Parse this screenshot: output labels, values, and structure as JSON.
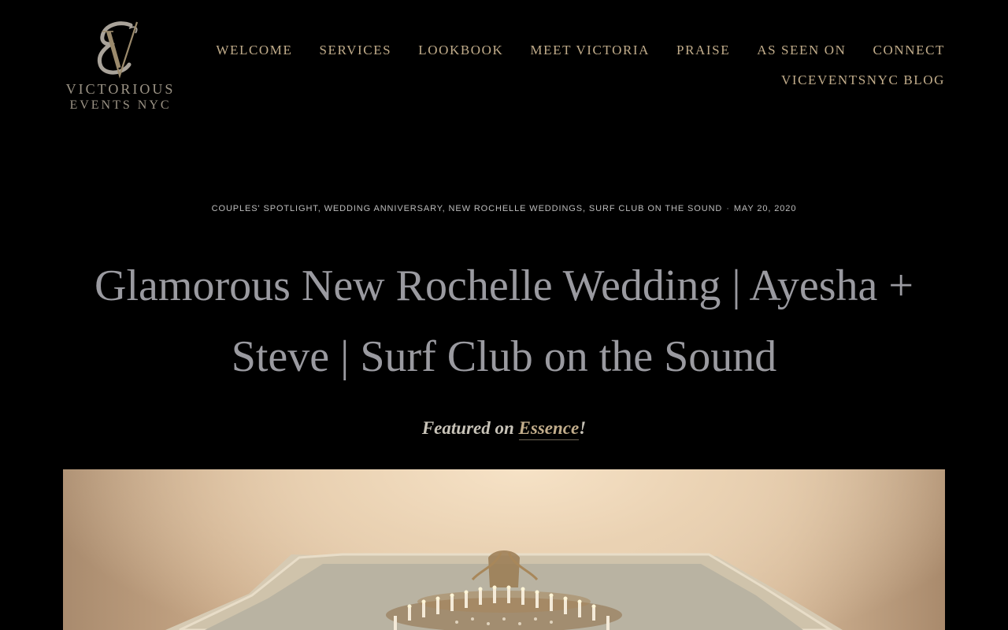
{
  "brand": {
    "name_line_1": "VICTORIOUS",
    "name_line_2": "EVENTS NYC",
    "logo_icon": "ve-monogram-icon",
    "gold": "#c2ad8b"
  },
  "nav": {
    "row_1": [
      {
        "key": "welcome",
        "label": "WELCOME"
      },
      {
        "key": "services",
        "label": "SERVICES"
      },
      {
        "key": "lookbook",
        "label": "LOOKBOOK"
      },
      {
        "key": "meet-victoria",
        "label": "MEET VICTORIA"
      },
      {
        "key": "praise",
        "label": "PRAISE"
      },
      {
        "key": "as-seen-on",
        "label": "AS SEEN ON"
      },
      {
        "key": "connect",
        "label": "CONNECT"
      }
    ],
    "row_2": [
      {
        "key": "blog",
        "label": "VICEVENTSNYC BLOG"
      }
    ]
  },
  "post": {
    "categories": [
      "Couples' Spotlight",
      "Wedding Anniversary",
      "New Rochelle Weddings",
      "Surf Club on the Sound"
    ],
    "separator": ", ",
    "meta_dot": "·",
    "date": "May 20, 2020",
    "title": "Glamorous New Rochelle Wedding | Ayesha + Steve | Surf Club on the Sound",
    "featured_prefix": "Featured on ",
    "featured_link": "Essence",
    "featured_suffix": "!"
  },
  "hero_image": {
    "icon": "chandelier-photo"
  }
}
